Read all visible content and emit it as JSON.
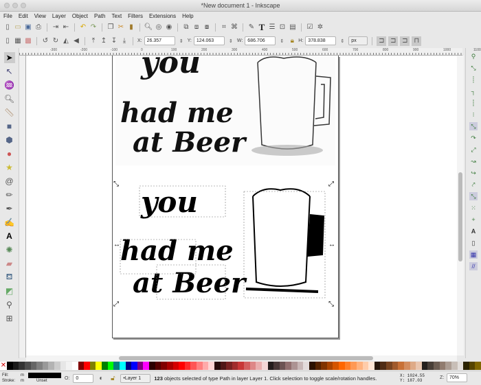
{
  "window": {
    "title": "*New document 1 - Inkscape"
  },
  "menu": [
    "File",
    "Edit",
    "View",
    "Layer",
    "Object",
    "Path",
    "Text",
    "Filters",
    "Extensions",
    "Help"
  ],
  "selector_toolbar": {
    "x_label": "X:",
    "x": "26.357",
    "y_label": "Y:",
    "y": "124.063",
    "w_label": "W:",
    "w": "686.706",
    "h_label": "H:",
    "h": "378.838",
    "unit": "px"
  },
  "ruler_ticks": [
    "-300",
    "-200",
    "-100",
    "0",
    "100",
    "200",
    "300",
    "400",
    "500",
    "600",
    "700",
    "800",
    "900",
    "1000",
    "1100"
  ],
  "artwork": {
    "line1": "you",
    "line2": "had me",
    "line3": "at Beer"
  },
  "palette": [
    "#000000",
    "#1a1a1a",
    "#333333",
    "#4d4d4d",
    "#666666",
    "#808080",
    "#999999",
    "#b3b3b3",
    "#cccccc",
    "#e6e6e6",
    "#f2f2f2",
    "#ffffff",
    "#800000",
    "#ff0000",
    "#808000",
    "#ffff00",
    "#008000",
    "#00ff00",
    "#008080",
    "#00ffff",
    "#000080",
    "#0000ff",
    "#800080",
    "#ff00ff",
    "#2b0000",
    "#550000",
    "#800000",
    "#aa0000",
    "#d40000",
    "#ff0000",
    "#ff2a2a",
    "#ff5555",
    "#ff8080",
    "#ffaaaa",
    "#ffd5d5",
    "#280b0b",
    "#501616",
    "#782121",
    "#a02c2c",
    "#c83737",
    "#d35f5f",
    "#de8787",
    "#e9afaf",
    "#f4d7d7",
    "#241c1c",
    "#483737",
    "#6c5353",
    "#916f6f",
    "#ac9393",
    "#c8b7b7",
    "#e3dbdb",
    "#2b1100",
    "#552200",
    "#803300",
    "#aa4400",
    "#d45500",
    "#ff6600",
    "#ff7f2a",
    "#ff9955",
    "#ffb380",
    "#ffccaa",
    "#ffe6d5",
    "#28170b",
    "#502d16",
    "#784421",
    "#a05a2c",
    "#c87137",
    "#d38d5f",
    "#deaa87",
    "#e9c6af",
    "#241f1c",
    "#483e37",
    "#6c5d53",
    "#917c6f",
    "#ac9d93",
    "#c8beb7",
    "#e3dedb",
    "#2b2200",
    "#554400",
    "#806600"
  ],
  "status": {
    "fill_label": "Fill:",
    "fill_value": "m",
    "stroke_label": "Stroke:",
    "stroke_value": "m",
    "stroke_unset": "Unset",
    "opacity_label": "O:",
    "opacity": "0",
    "layer": "•Layer 1",
    "message_count": "123",
    "message": " objects selected of type Path in layer Layer 1. Click selection to toggle scale/rotation handles.",
    "cursor_x": "X: 1024.55",
    "cursor_y": "Y: 187.03",
    "zoom_label": "Z:",
    "zoom": "70%"
  }
}
